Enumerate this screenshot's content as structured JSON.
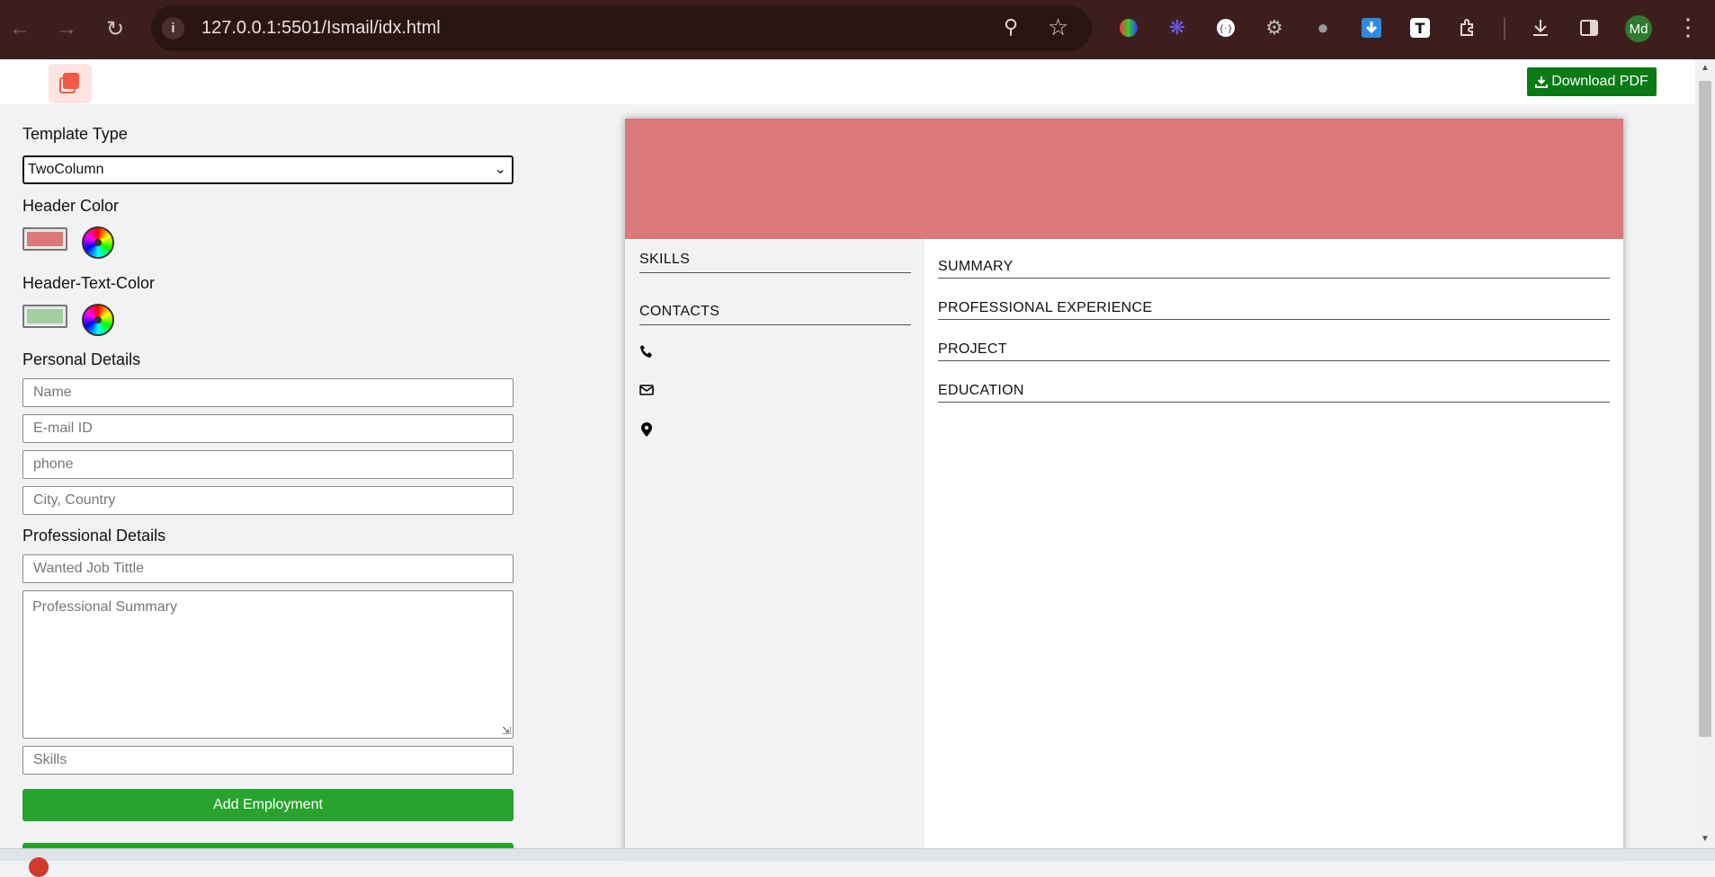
{
  "browser": {
    "url": "127.0.0.1:5501/Ismail/idx.html",
    "profile_initials": "Md"
  },
  "topbar": {
    "download_label": "Download PDF"
  },
  "form": {
    "template_type_label": "Template Type",
    "template_type_value": "TwoColumn",
    "header_color_label": "Header Color",
    "header_color_value": "#db7879",
    "header_text_color_label": "Header-Text-Color",
    "header_text_color_value": "#a3cfa3",
    "personal_details_label": "Personal Details",
    "name_placeholder": "Name",
    "email_placeholder": "E-mail ID",
    "phone_placeholder": "phone",
    "city_placeholder": "City, Country",
    "professional_details_label": "Professional Details",
    "job_title_placeholder": "Wanted Job Tittle",
    "summary_placeholder": "Professional Summary",
    "skills_placeholder": "Skills",
    "add_employment_label": "Add Employment"
  },
  "resume": {
    "header_color": "#db7879",
    "left_sections": [
      "SKILLS",
      "CONTACTS"
    ],
    "right_sections": [
      "SUMMARY",
      "PROFESSIONAL EXPERIENCE",
      "PROJECT",
      "EDUCATION"
    ],
    "contact_icons": [
      "phone-icon",
      "envelope-icon",
      "map-marker-icon"
    ]
  }
}
